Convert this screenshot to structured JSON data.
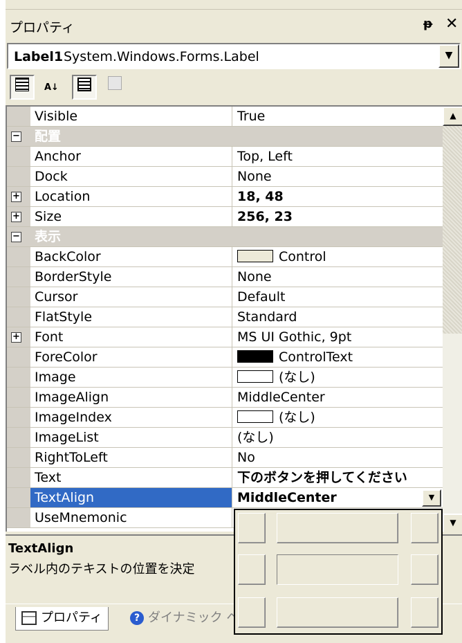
{
  "window": {
    "title": "プロパティ",
    "pin_glyph": "ᵽ",
    "close_glyph": "✕"
  },
  "object_selector": {
    "name": "Label1",
    "type": "System.Windows.Forms.Label",
    "arrow": "▼"
  },
  "toolbar": {
    "items": [
      "categorized",
      "alphabetical",
      "properties",
      "property-pages"
    ],
    "az_glyph": "A↓"
  },
  "grid": {
    "rows": [
      {
        "kind": "prop",
        "name": "Visible",
        "value": "True"
      },
      {
        "kind": "cat",
        "name": "配置"
      },
      {
        "kind": "prop",
        "name": "Anchor",
        "value": "Top, Left"
      },
      {
        "kind": "prop",
        "name": "Dock",
        "value": "None"
      },
      {
        "kind": "prop",
        "expander": "+",
        "name": "Location",
        "value": "18, 48",
        "bold": true
      },
      {
        "kind": "prop",
        "expander": "+",
        "name": "Size",
        "value": "256, 23",
        "bold": true
      },
      {
        "kind": "cat",
        "name": "表示"
      },
      {
        "kind": "prop",
        "name": "BackColor",
        "value": "Control",
        "swatch": "#ece9d8"
      },
      {
        "kind": "prop",
        "name": "BorderStyle",
        "value": "None"
      },
      {
        "kind": "prop",
        "name": "Cursor",
        "value": "Default"
      },
      {
        "kind": "prop",
        "name": "FlatStyle",
        "value": "Standard"
      },
      {
        "kind": "prop",
        "expander": "+",
        "name": "Font",
        "value": "MS UI Gothic, 9pt"
      },
      {
        "kind": "prop",
        "name": "ForeColor",
        "value": "ControlText",
        "swatch": "#000000"
      },
      {
        "kind": "prop",
        "name": "Image",
        "value": "(なし)",
        "swatch": "#ffffff"
      },
      {
        "kind": "prop",
        "name": "ImageAlign",
        "value": "MiddleCenter"
      },
      {
        "kind": "prop",
        "name": "ImageIndex",
        "value": "(なし)",
        "swatch": "#ffffff"
      },
      {
        "kind": "prop",
        "name": "ImageList",
        "value": "(なし)"
      },
      {
        "kind": "prop",
        "name": "RightToLeft",
        "value": "No"
      },
      {
        "kind": "prop",
        "name": "Text",
        "value": "下のボタンを押してください",
        "bold": true
      },
      {
        "kind": "prop",
        "name": "TextAlign",
        "value": "MiddleCenter",
        "bold": true,
        "selected": true,
        "dropdown": true
      },
      {
        "kind": "prop",
        "name": "UseMnemonic",
        "value": ""
      }
    ],
    "scroll_up": "▲",
    "scroll_down": "▼"
  },
  "description": {
    "title": "TextAlign",
    "text": "ラベル内のテキストの位置を決定"
  },
  "tabs": {
    "properties": "プロパティ",
    "dynamic_help": "ダイナミック ヘルプ",
    "help_glyph": "?"
  },
  "colors": {
    "selection": "#316ac5",
    "category_bg": "#d4d0c8",
    "panel_bg": "#ece9d8"
  },
  "text_align_editor": {
    "selected": "MiddleCenter"
  }
}
